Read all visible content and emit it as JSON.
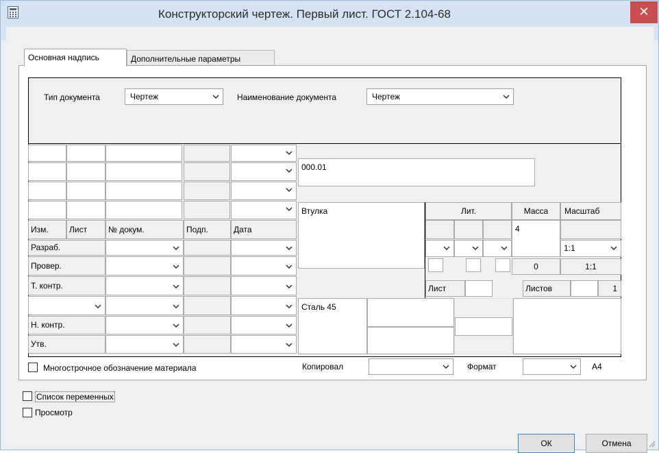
{
  "window": {
    "title": "Конструкторский чертеж. Первый лист. ГОСТ 2.104-68",
    "close_glyph": "✕"
  },
  "tabs": [
    {
      "label": "Основная надпись"
    },
    {
      "label": "Дополнительные параметры"
    }
  ],
  "document": {
    "type_label": "Тип документа",
    "type_value": "Чертеж",
    "name_label": "Наименование документа",
    "name_value": "Чертеж"
  },
  "stamp": {
    "designation": "000.01",
    "part_name": "Втулка",
    "material": "Сталь 45",
    "headers": {
      "izm": "Изм.",
      "list": "Лист",
      "doc_no": "№ докум.",
      "sign": "Подп.",
      "date": "Дата"
    },
    "roles": {
      "razrab": "Разраб.",
      "prover": "Провер.",
      "t_kontr": "Т. контр.",
      "n_kontr": "Н. контр.",
      "utv": "Утв."
    },
    "lit_label": "Лит.",
    "mass_label": "Масса",
    "mass_value": "4",
    "scale_label": "Масштаб",
    "scale_select": "1:1",
    "mass_computed": "0",
    "scale_computed": "1:1",
    "sheet_label": "Лист",
    "sheets_label": "Листов",
    "sheets_value": "1"
  },
  "bottom": {
    "multiline_material_label": "Многострочное обозначение материала",
    "copied_label": "Копировал",
    "format_label": "Формат",
    "format_value": "A4"
  },
  "options": {
    "variables_label": "Список переменных",
    "preview_label": "Просмотр"
  },
  "buttons": {
    "ok": "ОК",
    "cancel": "Отмена"
  },
  "colors": {
    "titlebar": "#d4e3f3",
    "close": "#c94f4f",
    "client": "#f0f0f0",
    "accent_border": "#3c7fb1"
  }
}
